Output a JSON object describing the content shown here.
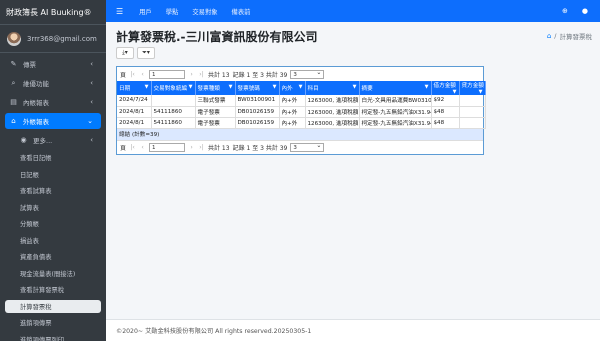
{
  "app": {
    "brand": "財政簿長 AI Buuking®"
  },
  "user": {
    "email": "3rrr368@gmail.com"
  },
  "sidebar": {
    "items": [
      {
        "label": "傳票",
        "icon": "edit-icon",
        "chev": "‹"
      },
      {
        "label": "維優功能",
        "icon": "search-icon",
        "chev": "‹"
      },
      {
        "label": "內帳報表",
        "icon": "book-icon",
        "chev": "‹"
      },
      {
        "label": "外帳報表",
        "icon": "home-icon",
        "chev": "⌄"
      }
    ],
    "more": {
      "label": "更多...",
      "chev": "‹"
    },
    "subitems": [
      "查看日記帳",
      "日記帳",
      "查看試算表",
      "試算表",
      "分類帳",
      "損益表",
      "資產負債表",
      "現金流量表(間接法)",
      "查看計算發票稅",
      "計算發票稅",
      "進銷項傳票",
      "進銷項傳票列印"
    ]
  },
  "topbar": {
    "links": [
      "用戶",
      "學點",
      "交易對象",
      "備表前"
    ],
    "right_icons": [
      "globe-icon",
      "user-icon"
    ]
  },
  "page": {
    "title": "計算發票稅.-三川富資訊股份有限公司",
    "breadcrumb": "計算發票稅"
  },
  "grid": {
    "pager": {
      "page_label": "頁",
      "page_value": "1",
      "total_pages": "共計 13",
      "records": "記錄 1 至 3 共計 39",
      "page_size": "3"
    },
    "columns": [
      "日期",
      "交易對象統編",
      "發票種類",
      "發票號碼",
      "內外",
      "科目",
      "摘要",
      "借方金額",
      "貸方金額"
    ],
    "rows": [
      [
        "2024/7/24",
        "",
        "三聯式發票",
        "BW03100901",
        "內+外",
        "1263000, 進項稅額",
        "白光-文具用品運費BW03100901",
        "$92",
        ""
      ],
      [
        "2024/8/1",
        "54111860",
        "電子發票",
        "DB01026159",
        "內+外",
        "1263000, 進項稅額",
        "柯定發-九五無鉛汽油X31.94X31.3-",
        "$48",
        ""
      ],
      [
        "2024/8/1",
        "54111860",
        "電子發票",
        "DB01026159",
        "內+外",
        "1263000, 進項稅額",
        "柯定發-九五無鉛汽油X31.94X31.3-",
        "$48",
        ""
      ]
    ],
    "total": "總結 (計數=39)"
  },
  "footer": {
    "text": "©2020~ 艾勛金科技股份有限公司 All rights reserved.20250305-1"
  }
}
